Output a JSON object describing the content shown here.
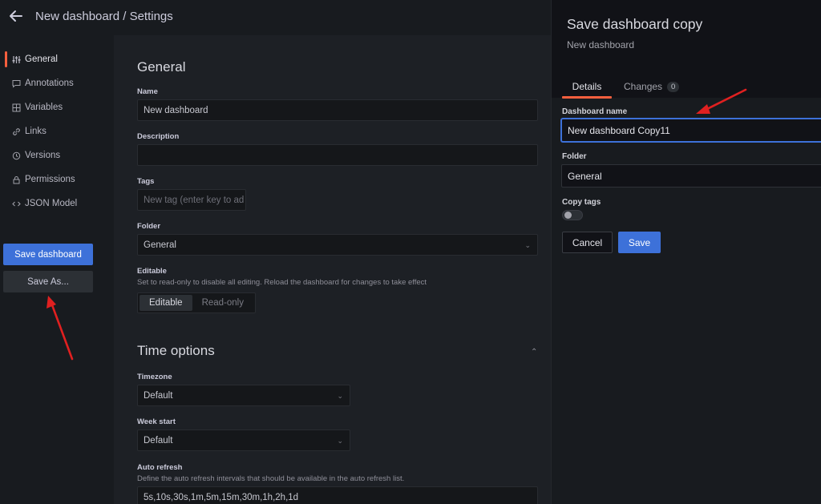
{
  "header": {
    "title": "New dashboard / Settings"
  },
  "sidebar": {
    "items": [
      {
        "label": "General",
        "icon": "sliders-icon"
      },
      {
        "label": "Annotations",
        "icon": "comment-icon"
      },
      {
        "label": "Variables",
        "icon": "calculator-icon"
      },
      {
        "label": "Links",
        "icon": "link-icon"
      },
      {
        "label": "Versions",
        "icon": "history-icon"
      },
      {
        "label": "Permissions",
        "icon": "lock-icon"
      },
      {
        "label": "JSON Model",
        "icon": "code-icon"
      }
    ],
    "save_dashboard_label": "Save dashboard",
    "save_as_label": "Save As..."
  },
  "general": {
    "title": "General",
    "name_label": "Name",
    "name_value": "New dashboard",
    "description_label": "Description",
    "description_value": "",
    "tags_label": "Tags",
    "tags_placeholder": "New tag (enter key to ad",
    "folder_label": "Folder",
    "folder_value": "General",
    "editable_label": "Editable",
    "editable_desc": "Set to read-only to disable all editing. Reload the dashboard for changes to take effect",
    "editable_options": [
      "Editable",
      "Read-only"
    ]
  },
  "time_options": {
    "title": "Time options",
    "timezone_label": "Timezone",
    "timezone_value": "Default",
    "week_start_label": "Week start",
    "week_start_value": "Default",
    "auto_refresh_label": "Auto refresh",
    "auto_refresh_desc": "Define the auto refresh intervals that should be available in the auto refresh list.",
    "auto_refresh_value": "5s,10s,30s,1m,5m,15m,30m,1h,2h,1d"
  },
  "drawer": {
    "title": "Save dashboard copy",
    "subtitle": "New dashboard",
    "tabs": {
      "details": "Details",
      "changes": "Changes",
      "changes_count": "0"
    },
    "dashboard_name_label": "Dashboard name",
    "dashboard_name_value": "New dashboard Copy11",
    "folder_label": "Folder",
    "folder_value": "General",
    "copy_tags_label": "Copy tags",
    "copy_tags_on": false,
    "cancel_label": "Cancel",
    "save_label": "Save"
  },
  "colors": {
    "accent": "#f55f3e",
    "primary": "#3d71d9",
    "annotation": "#e02020"
  }
}
